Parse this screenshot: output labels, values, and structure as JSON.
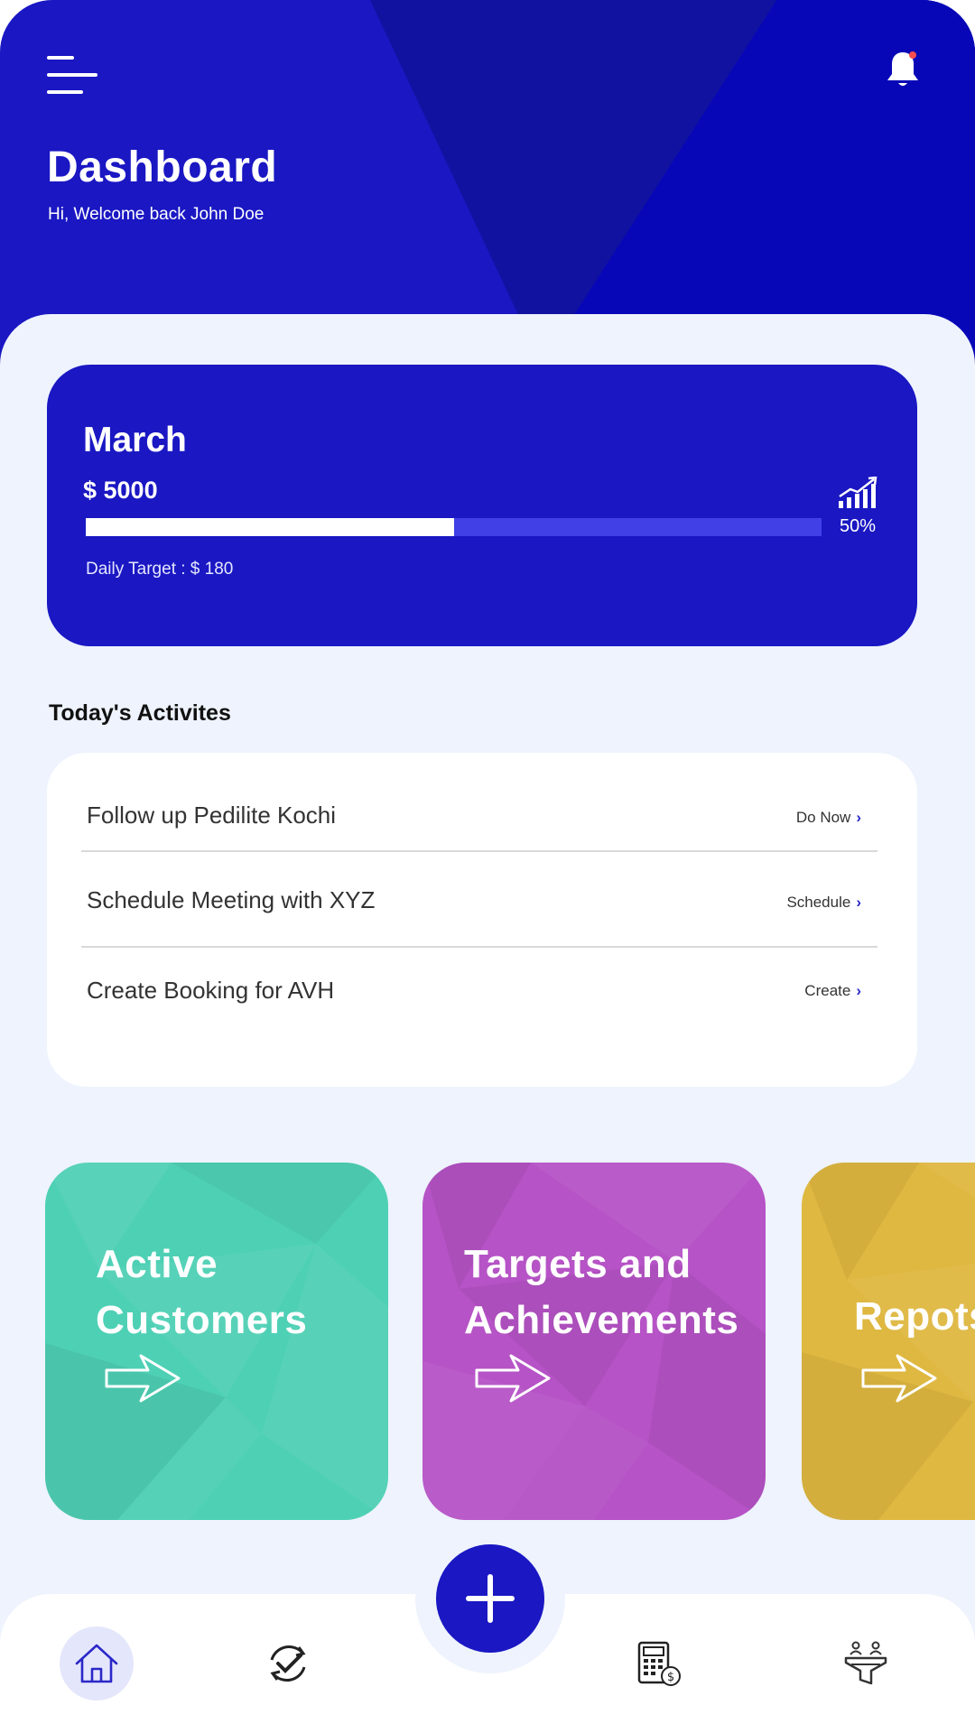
{
  "header": {
    "title": "Dashboard",
    "subtitle": "Hi, Welcome back John Doe"
  },
  "month_card": {
    "month": "March",
    "amount": "$ 5000",
    "progress_fraction": 0.5,
    "progress_label": "50%",
    "daily_target": "Daily Target : $ 180"
  },
  "activities": {
    "title": "Today's Activites",
    "items": [
      {
        "text": "Follow up Pedilite Kochi",
        "action": "Do Now"
      },
      {
        "text": "Schedule Meeting with XYZ",
        "action": "Schedule"
      },
      {
        "text": "Create Booking for AVH",
        "action": "Create"
      }
    ]
  },
  "tiles": [
    {
      "label_line1": "Active",
      "label_line2": "Customers",
      "color": "#4ed0b5"
    },
    {
      "label_line1": "Targets and",
      "label_line2": "Achievements",
      "color": "#b653c6"
    },
    {
      "label_line1": "Repots",
      "color": "#dfb841"
    }
  ],
  "nav": {
    "items": [
      "home-icon",
      "task-check-icon",
      "calculator-icon",
      "funnel-people-icon"
    ],
    "fab_icon": "plus-icon",
    "active": "home-icon"
  },
  "colors": {
    "primary": "#1a17c3",
    "background": "#eef3fd",
    "progress_track": "#4040e6"
  }
}
